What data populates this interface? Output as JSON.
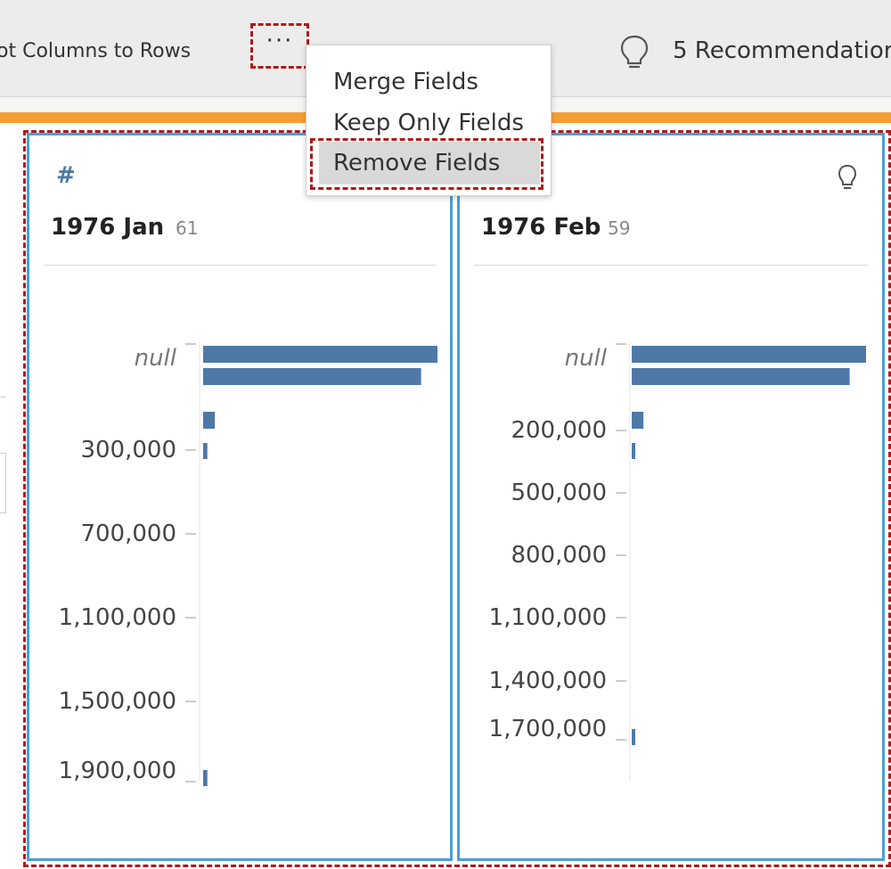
{
  "toolbar": {
    "pivot_label": "ot Columns to Rows",
    "more_label": "···",
    "recommendations_label": "5 Recommendatior"
  },
  "menu": {
    "items": [
      {
        "label": "Merge Fields"
      },
      {
        "label": "Keep Only Fields"
      },
      {
        "label": "Remove Fields",
        "hovered": true
      }
    ]
  },
  "colors": {
    "accent_orange": "#f59f32",
    "card_border": "#4a9fd8",
    "selection_dashes": "#b01a1a",
    "bar": "#4e79a7"
  },
  "chart_data": [
    {
      "type": "bar",
      "title": "1976 Jan",
      "count": "61",
      "type_icon": "#",
      "tick_labels": [
        "null",
        "300,000",
        "700,000",
        "1,100,000",
        "1,500,000",
        "1,900,000"
      ],
      "bars": [
        {
          "bin": "null",
          "value": 1.0
        },
        {
          "bin": "null",
          "value": 0.93
        },
        {
          "bin": "~200,000",
          "value": 0.05
        },
        {
          "bin": "~300,000",
          "value": 0.018
        },
        {
          "bin": "~1,900,000",
          "value": 0.018
        }
      ]
    },
    {
      "type": "bar",
      "title": "1976 Feb",
      "count": "59",
      "tick_labels": [
        "null",
        "200,000",
        "500,000",
        "800,000",
        "1,100,000",
        "1,400,000",
        "1,700,000"
      ],
      "bars": [
        {
          "bin": "null",
          "value": 1.0
        },
        {
          "bin": "null",
          "value": 0.93
        },
        {
          "bin": "~200,000",
          "value": 0.05
        },
        {
          "bin": "~250,000",
          "value": 0.015
        },
        {
          "bin": "~1,700,000",
          "value": 0.015
        }
      ]
    }
  ]
}
